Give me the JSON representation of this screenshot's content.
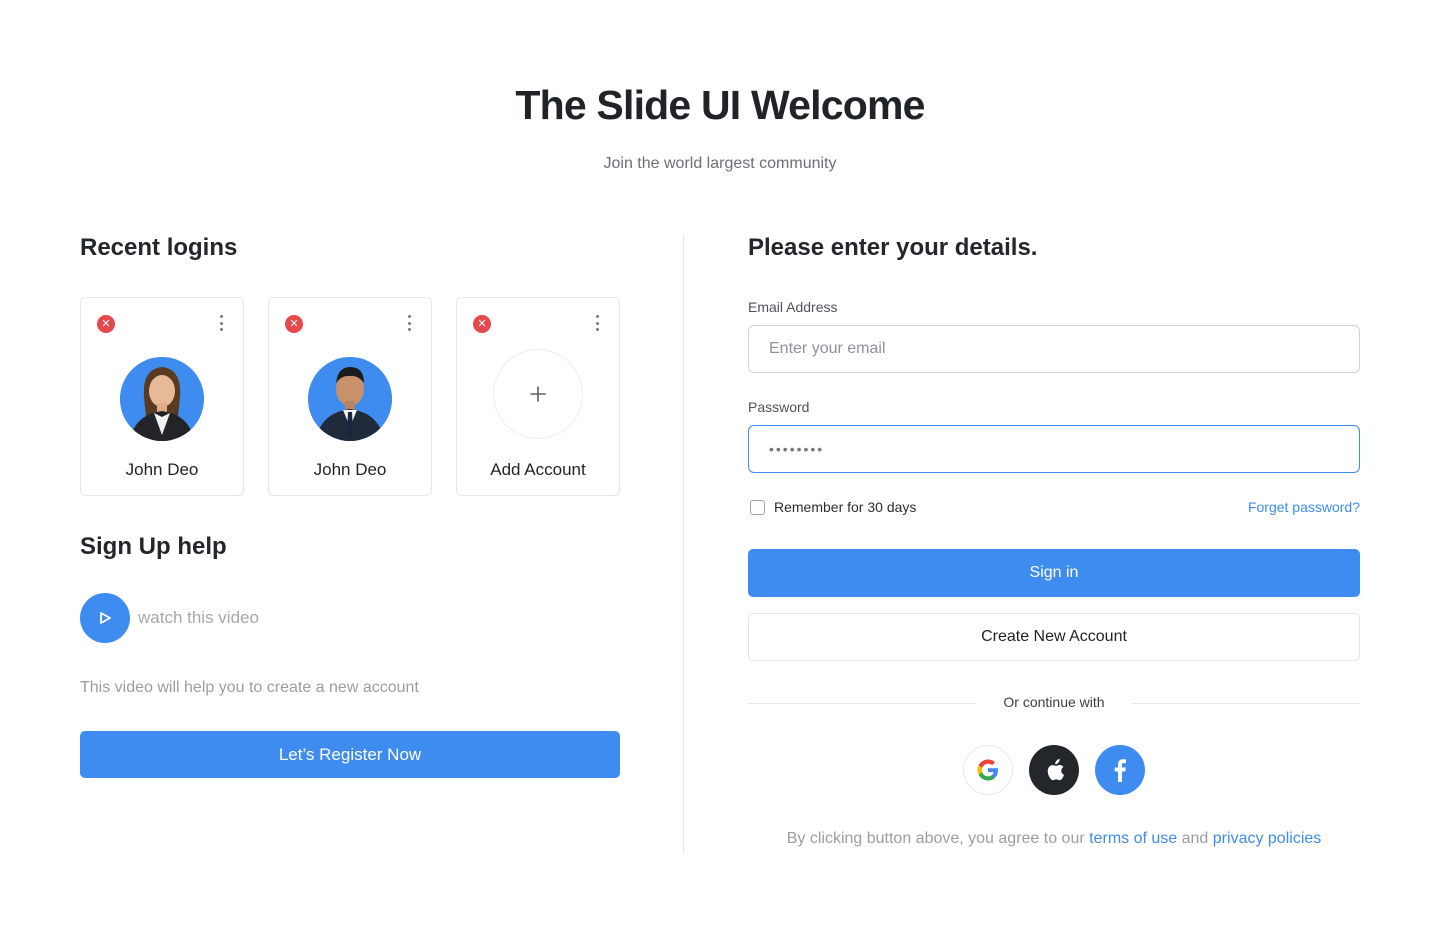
{
  "header": {
    "title": "The Slide UI Welcome",
    "subtitle": "Join the world largest community"
  },
  "recent_logins": {
    "title": "Recent logins",
    "accounts": [
      {
        "name": "John Deo",
        "avatar": "female-avatar"
      },
      {
        "name": "John Deo",
        "avatar": "male-avatar"
      }
    ],
    "add_account_label": "Add Account"
  },
  "signup_help": {
    "title": "Sign Up help",
    "video_label": "watch this video",
    "description": "This video will help you to create a new account",
    "register_button": "Let’s Register Now"
  },
  "login_form": {
    "title": "Please enter your details.",
    "email_label": "Email Address",
    "email_placeholder": "Enter your email",
    "password_label": "Password",
    "password_value": "••••••••",
    "remember_label": "Remember for 30 days",
    "forget_link": "Forget password?",
    "signin_button": "Sign in",
    "create_button": "Create New Account",
    "or_text": "Or continue with",
    "socials": [
      "google-icon",
      "apple-icon",
      "facebook-icon"
    ],
    "terms_prefix": "By clicking button above, you agree to our",
    "terms_link": "terms of use",
    "terms_and": "and",
    "privacy_link": "privacy policies"
  },
  "colors": {
    "accent": "#3f8cf0",
    "danger": "#e5484d",
    "text": "#1f2328"
  }
}
